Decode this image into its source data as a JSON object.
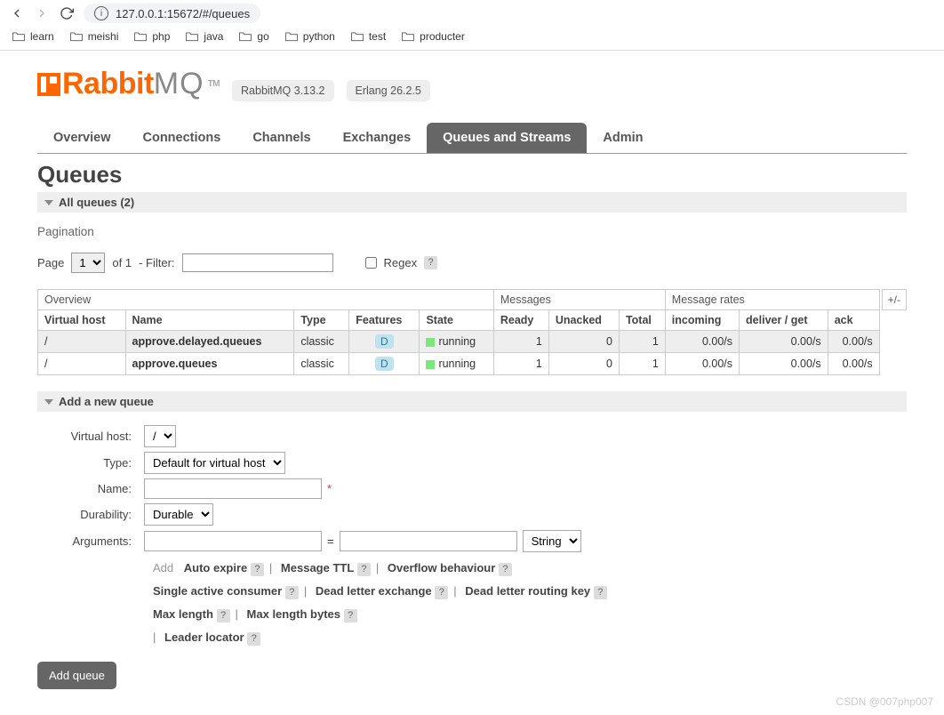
{
  "browser": {
    "url": "127.0.0.1:15672/#/queues",
    "bookmarks": [
      "learn",
      "meishi",
      "php",
      "java",
      "go",
      "python",
      "test",
      "producter"
    ]
  },
  "brand": {
    "name_a": "Rabbit",
    "name_b": "MQ",
    "tm": "TM",
    "version": "RabbitMQ 3.13.2",
    "erlang": "Erlang 26.2.5"
  },
  "tabs": [
    "Overview",
    "Connections",
    "Channels",
    "Exchanges",
    "Queues and Streams",
    "Admin"
  ],
  "active_tab": 4,
  "page_title": "Queues",
  "all_queues_label": "All queues (2)",
  "pagination_label": "Pagination",
  "pag": {
    "page_label": "Page",
    "page_value": "1",
    "of_label": "of 1",
    "filter_label": "- Filter:",
    "filter_value": "",
    "regex_label": "Regex"
  },
  "table": {
    "groups": {
      "overview": "Overview",
      "messages": "Messages",
      "rates": "Message rates"
    },
    "cols": {
      "vhost": "Virtual host",
      "name": "Name",
      "type": "Type",
      "features": "Features",
      "state": "State",
      "ready": "Ready",
      "unacked": "Unacked",
      "total": "Total",
      "incoming": "incoming",
      "deliver": "deliver / get",
      "ack": "ack"
    },
    "plusminus": "+/-",
    "rows": [
      {
        "vhost": "/",
        "name": "approve.delayed.queues",
        "type": "classic",
        "feat": "D",
        "state": "running",
        "ready": "1",
        "unacked": "0",
        "total": "1",
        "incoming": "0.00/s",
        "deliver": "0.00/s",
        "ack": "0.00/s"
      },
      {
        "vhost": "/",
        "name": "approve.queues",
        "type": "classic",
        "feat": "D",
        "state": "running",
        "ready": "1",
        "unacked": "0",
        "total": "1",
        "incoming": "0.00/s",
        "deliver": "0.00/s",
        "ack": "0.00/s"
      }
    ]
  },
  "add_section_label": "Add a new queue",
  "form": {
    "vhost_label": "Virtual host:",
    "vhost_value": "/",
    "type_label": "Type:",
    "type_value": "Default for virtual host",
    "name_label": "Name:",
    "name_value": "",
    "dur_label": "Durability:",
    "dur_value": "Durable",
    "args_label": "Arguments:",
    "arg_key": "",
    "arg_val": "",
    "arg_type": "String",
    "add_hint_label": "Add",
    "hints": [
      "Auto expire",
      "Message TTL",
      "Overflow behaviour",
      "Single active consumer",
      "Dead letter exchange",
      "Dead letter routing key",
      "Max length",
      "Max length bytes",
      "Leader locator"
    ]
  },
  "add_button": "Add queue",
  "watermark": "CSDN @007php007"
}
